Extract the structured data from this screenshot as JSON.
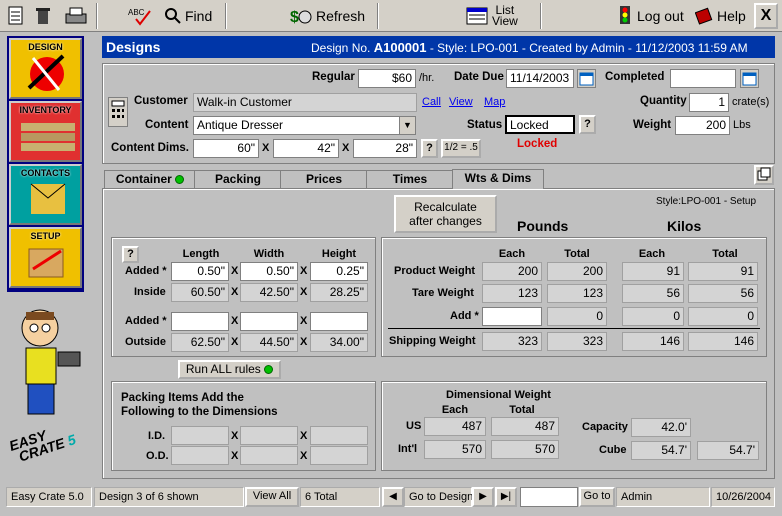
{
  "toolbar": {
    "find": "Find",
    "refresh": "Refresh",
    "list_view": "List\nView",
    "log_out": "Log out",
    "help": "Help",
    "close": "X"
  },
  "sidebar": {
    "items": [
      {
        "label": "DESIGN"
      },
      {
        "label": "INVENTORY"
      },
      {
        "label": "CONTACTS"
      },
      {
        "label": "SETUP"
      }
    ],
    "logo": "EASY CRATE 5"
  },
  "title": {
    "section": "Designs",
    "info_prefix": "Design No.",
    "design_no": "A100001",
    "info_suffix": "- Style: LPO-001 - Created by Admin  -  11/12/2003 11:59 AM"
  },
  "form": {
    "regular_label": "Regular",
    "regular_value": "$60",
    "regular_unit": "/hr.",
    "date_due_label": "Date Due",
    "date_due_value": "11/14/2003",
    "completed_label": "Completed",
    "completed_value": "",
    "customer_label": "Customer",
    "customer_value": "Walk-in Customer",
    "call": "Call",
    "view": "View",
    "map": "Map",
    "quantity_label": "Quantity",
    "quantity_value": "1",
    "quantity_unit": "crate(s)",
    "content_label": "Content",
    "content_value": "Antique Dresser",
    "status_label": "Status",
    "status_value": "Locked",
    "status_help": "?",
    "weight_label": "Weight",
    "weight_value": "200",
    "weight_unit": "Lbs",
    "dims_label": "Content Dims.",
    "dim1": "60\"",
    "dim2": "42\"",
    "dim3": "28\"",
    "dims_help": "?",
    "half": "1/2 = .5",
    "locked_text": "Locked"
  },
  "tabs": [
    "Container",
    "Packing",
    "Prices",
    "Times",
    "Wts & Dims"
  ],
  "style_setup": "Style:LPO-001 - Setup",
  "recalc": "Recalculate\nafter changes",
  "dims_panel": {
    "help": "?",
    "headers": [
      "Length",
      "Width",
      "Height"
    ],
    "rows": [
      {
        "label": "Added *",
        "values": [
          "0.50\"",
          "0.50\"",
          "0.25\""
        ]
      },
      {
        "label": "Inside",
        "values": [
          "60.50\"",
          "42.50\"",
          "28.25\""
        ]
      },
      {
        "label": "Added *",
        "values": [
          "",
          "",
          ""
        ]
      },
      {
        "label": "Outside",
        "values": [
          "62.50\"",
          "44.50\"",
          "34.00\""
        ]
      }
    ]
  },
  "weights_panel": {
    "pounds": "Pounds",
    "kilos": "Kilos",
    "each": "Each",
    "total": "Total",
    "rows": [
      {
        "label": "Product Weight",
        "lb_each": "200",
        "lb_total": "200",
        "kg_each": "91",
        "kg_total": "91"
      },
      {
        "label": "Tare Weight",
        "lb_each": "123",
        "lb_total": "123",
        "kg_each": "56",
        "kg_total": "56"
      },
      {
        "label": "Add *",
        "lb_each": "",
        "lb_total": "0",
        "kg_each": "0",
        "kg_total": "0"
      },
      {
        "label": "Shipping Weight",
        "lb_each": "323",
        "lb_total": "323",
        "kg_each": "146",
        "kg_total": "146"
      }
    ]
  },
  "run_rules": "Run ALL rules",
  "packing_panel": {
    "title": "Packing Items Add the\nFollowing to the Dimensions",
    "id_label": "I.D.",
    "od_label": "O.D."
  },
  "dimweight_panel": {
    "title": "Dimensional Weight",
    "each": "Each",
    "total": "Total",
    "us_label": "US",
    "us_each": "487",
    "us_total": "487",
    "intl_label": "Int'l",
    "intl_each": "570",
    "intl_total": "570",
    "capacity_label": "Capacity",
    "capacity_value": "42.0'",
    "cube_label": "Cube",
    "cube_value1": "54.7'",
    "cube_value2": "54.7'"
  },
  "statusbar": {
    "app": "Easy Crate 5.0",
    "record": "Design 3 of 6 shown",
    "view_all": "View All",
    "total": "6 Total",
    "go_to_design": "Go to Design",
    "goto_value": "",
    "goto_btn": "Go to",
    "user": "Admin",
    "date": "10/26/2004"
  },
  "colors": {
    "title_bar": "#0036a8",
    "locked_red": "#e00000",
    "green_dot": "#00c000"
  }
}
